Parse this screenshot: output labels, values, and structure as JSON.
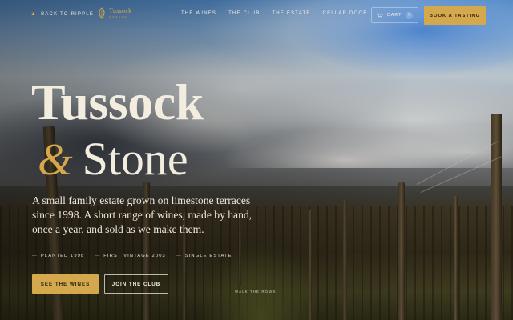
{
  "nav": {
    "back_label": "BACK TO RIPPLE",
    "logo_name": "Tussock",
    "logo_sub": "ESTATE",
    "menu": [
      "THE WINES",
      "THE CLUB",
      "THE ESTATE",
      "CELLAR DOOR"
    ],
    "cart_label": "CART",
    "cart_count": "0",
    "book_label": "BOOK A TASTING"
  },
  "hero": {
    "title_line1": "Tussock",
    "title_amp": "&",
    "title_line2": "Stone",
    "lede": "A small family estate grown on limestone terraces since 1998. A short range of wines, made by hand, once a year, and sold as we make them.",
    "facts": [
      "PLANTED 1998",
      "FIRST VINTAGE 2003",
      "SINGLE ESTATE"
    ],
    "cta_primary": "SEE THE WINES",
    "cta_secondary": "JOIN THE CLUB",
    "scroll_hint": "WALK THE ROWS"
  },
  "colors": {
    "accent_gold": "#d4a84c",
    "text_cream": "#f3ede0"
  },
  "icons": {
    "back": "arrow-left-icon",
    "logo": "vine-leaf-icon",
    "cart": "cart-icon"
  }
}
